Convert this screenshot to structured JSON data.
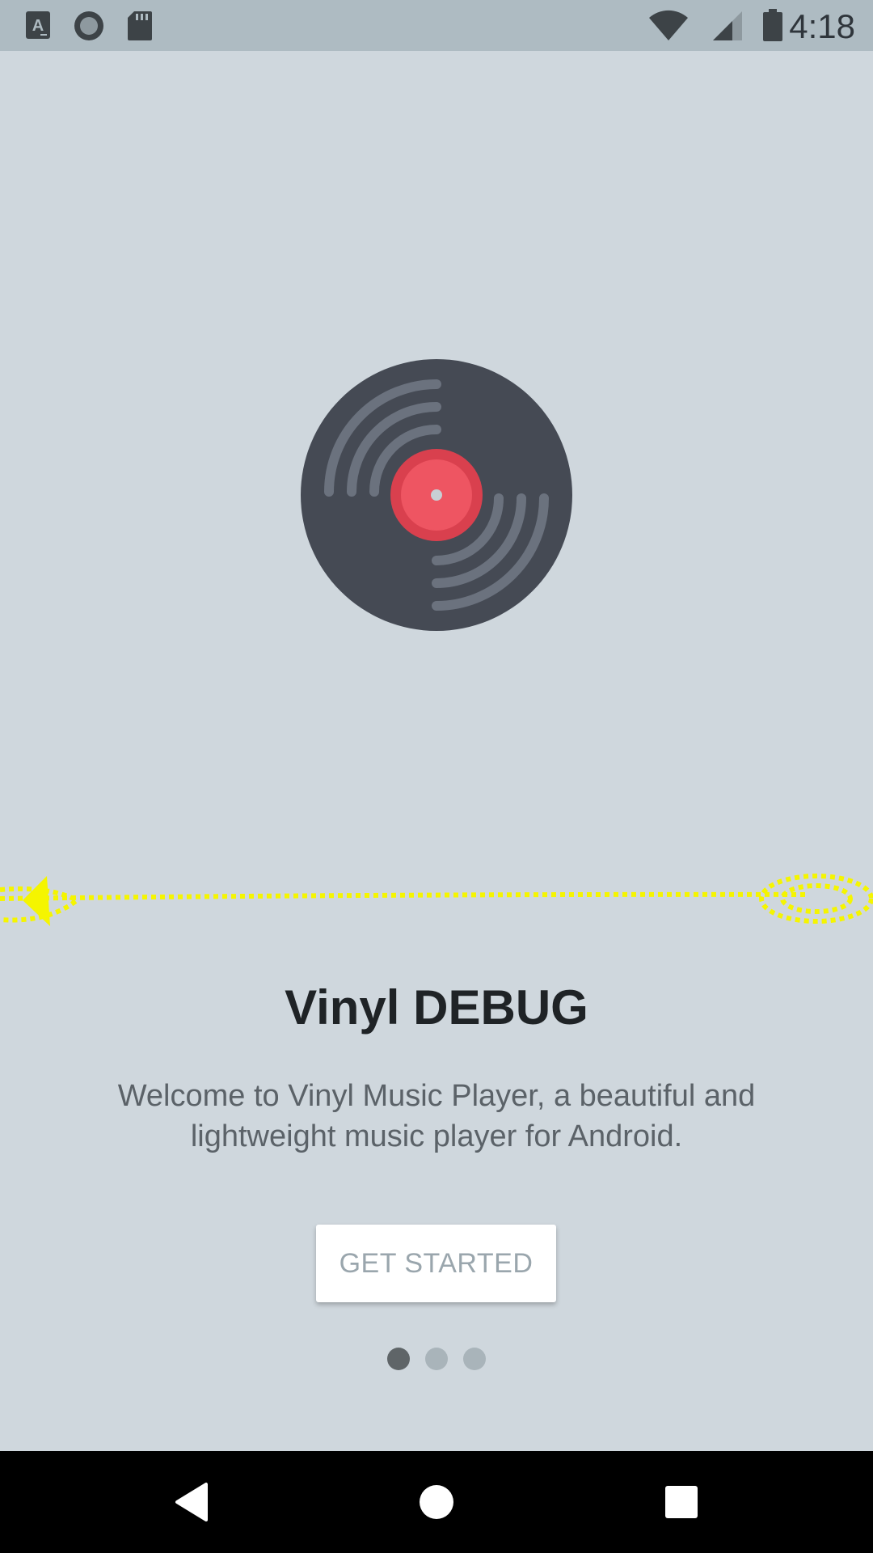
{
  "status_bar": {
    "time": "4:18",
    "left_icons": [
      "font-icon",
      "record-icon",
      "sd-card-icon"
    ],
    "right_icons": [
      "wifi-icon",
      "cellular-signal-icon",
      "battery-icon"
    ]
  },
  "welcome": {
    "title": "Vinyl DEBUG",
    "description": "Welcome to Vinyl Music Player, a beautiful and lightweight music player for Android.",
    "button_label": "GET STARTED",
    "page_count": 3,
    "current_page": 1
  },
  "colors": {
    "background": "#cfd7dd",
    "status_bar": "#aebbc2",
    "vinyl_disc": "#454a54",
    "vinyl_grooves": "#6b727e",
    "vinyl_label": "#e84f5c",
    "gesture_trace": "#ffff00"
  },
  "nav_bar": {
    "buttons": [
      "back-icon",
      "home-icon",
      "recents-icon"
    ]
  }
}
